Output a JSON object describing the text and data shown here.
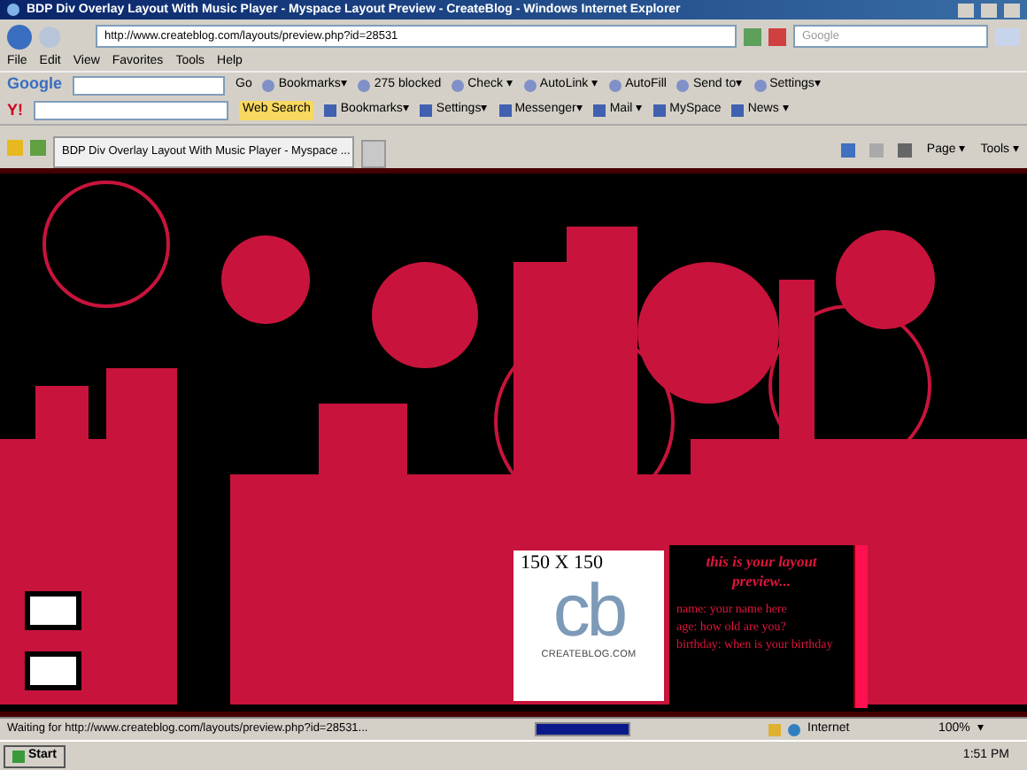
{
  "window": {
    "title": "BDP Div Overlay Layout With Music Player - Myspace Layout Preview - CreateBlog - Windows Internet Explorer"
  },
  "address_bar": {
    "url": "http://www.createblog.com/layouts/preview.php?id=28531",
    "search_placeholder": "Google"
  },
  "menu": [
    "File",
    "Edit",
    "View",
    "Favorites",
    "Tools",
    "Help"
  ],
  "google_toolbar": {
    "brand": "Google",
    "go": "Go",
    "items": [
      "Bookmarks▾",
      "275 blocked",
      "Check ▾",
      "AutoLink ▾",
      "AutoFill",
      "Send to▾",
      "Settings▾"
    ]
  },
  "yahoo_toolbar": {
    "brand": "Y!",
    "search_button": "Web Search",
    "items": [
      "Bookmarks▾",
      "Settings▾",
      "Messenger▾",
      "Mail ▾",
      "MySpace",
      "News ▾"
    ]
  },
  "tabs": [
    {
      "label": "BDP Div Overlay Layout With Music Player - Myspace ...",
      "selected": true
    }
  ],
  "command_bar": [
    "Page ▾",
    "Tools ▾"
  ],
  "page": {
    "logo_box": {
      "size_label": "150 X 150",
      "logo": "cb",
      "caption": "CREATEBLOG.COM"
    },
    "panel": {
      "heading": "this is your layout preview...",
      "lines": [
        "name: your name here",
        "age: how old are you?",
        "birthday: when is your birthday"
      ]
    }
  },
  "status_bar": {
    "text": "Waiting for http://www.createblog.com/layouts/preview.php?id=28531...",
    "progress": {
      "level": 1
    },
    "zone": "Internet",
    "zoom": "100%",
    "zoom_caret": "▾"
  },
  "taskbar": {
    "start": "Start",
    "clock": "1:51 PM"
  }
}
